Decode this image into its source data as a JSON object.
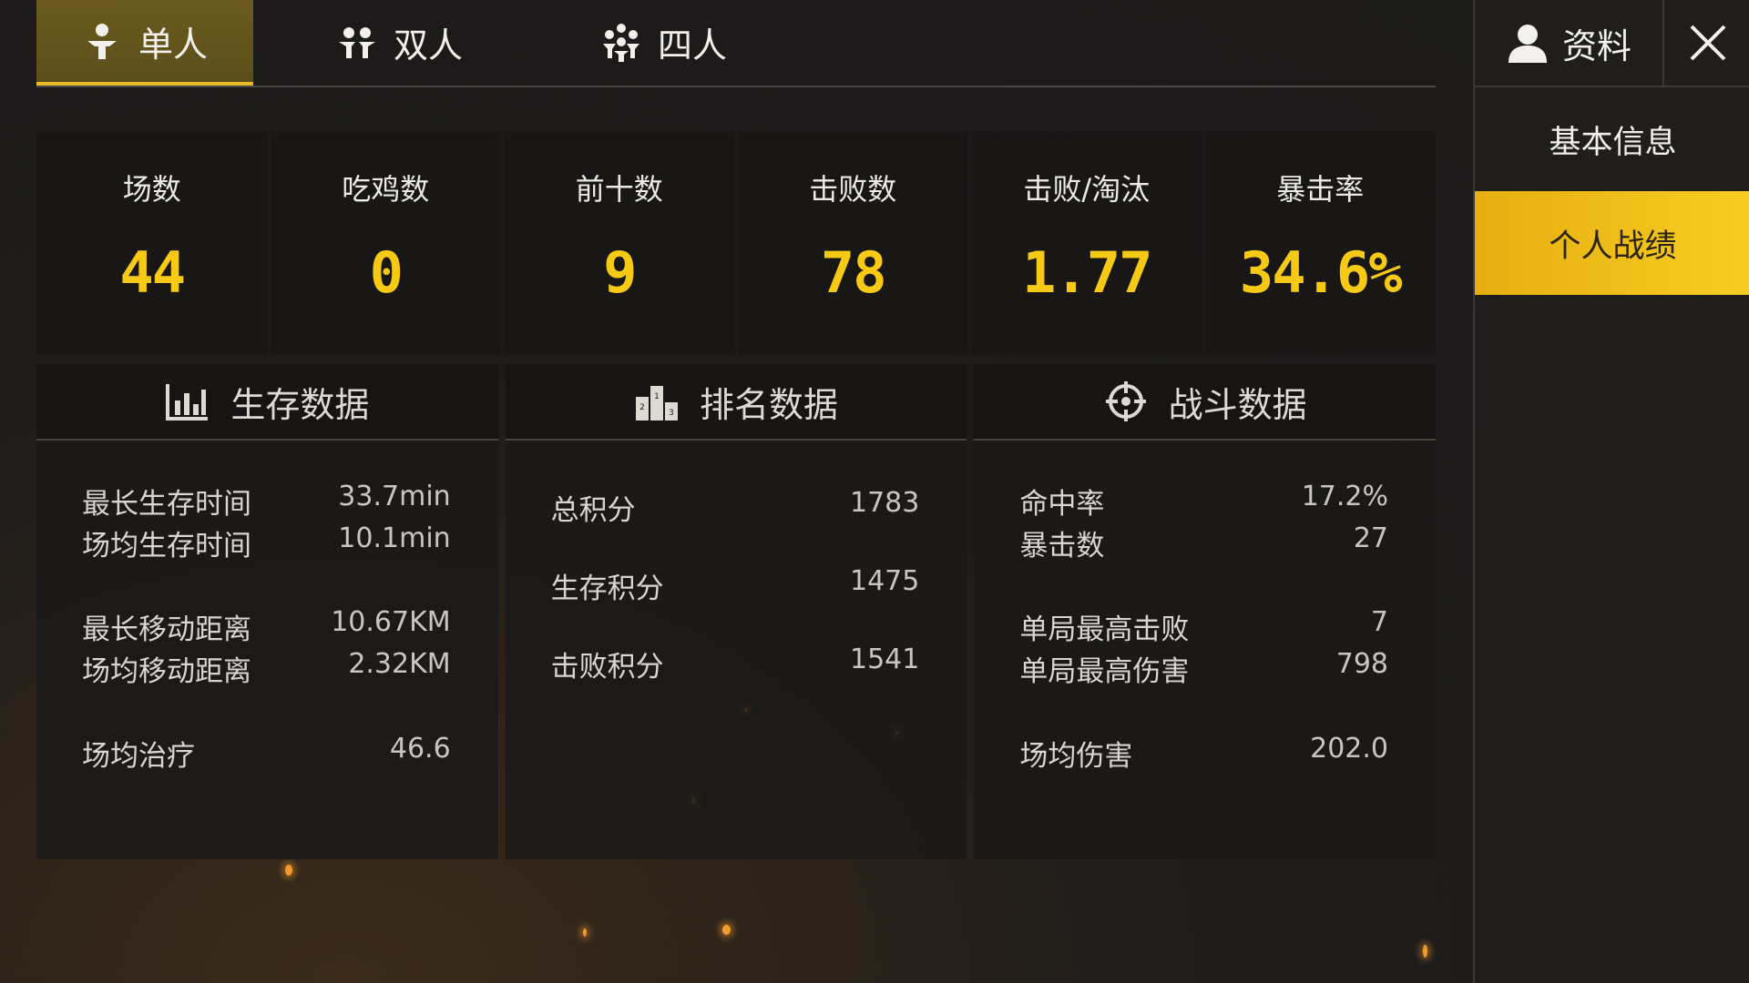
{
  "tabs": [
    {
      "label": "单人",
      "icon": "single-person-icon",
      "active": true
    },
    {
      "label": "双人",
      "icon": "duo-icon",
      "active": false
    },
    {
      "label": "四人",
      "icon": "squad-icon",
      "active": false
    }
  ],
  "stats": [
    {
      "label": "场数",
      "value": "44"
    },
    {
      "label": "吃鸡数",
      "value": "0"
    },
    {
      "label": "前十数",
      "value": "9"
    },
    {
      "label": "击败数",
      "value": "78"
    },
    {
      "label": "击败/淘汰",
      "value": "1.77"
    },
    {
      "label": "暴击率",
      "value": "34.6%"
    }
  ],
  "panels": {
    "survival": {
      "title": "生存数据",
      "rows": [
        {
          "k": "最长生存时间",
          "v": "33.7min"
        },
        {
          "k": "场均生存时间",
          "v": "10.1min"
        },
        {
          "k": "最长移动距离",
          "v": "10.67KM"
        },
        {
          "k": "场均移动距离",
          "v": "2.32KM"
        },
        {
          "k": "场均治疗",
          "v": "46.6"
        }
      ]
    },
    "ranking": {
      "title": "排名数据",
      "rows": [
        {
          "k": "总积分",
          "v": "1783"
        },
        {
          "k": "生存积分",
          "v": "1475"
        },
        {
          "k": "击败积分",
          "v": "1541"
        }
      ]
    },
    "combat": {
      "title": "战斗数据",
      "rows": [
        {
          "k": "命中率",
          "v": "17.2%"
        },
        {
          "k": "暴击数",
          "v": "27"
        },
        {
          "k": "单局最高击败",
          "v": "7"
        },
        {
          "k": "单局最高伤害",
          "v": "798"
        },
        {
          "k": "场均伤害",
          "v": "202.0"
        }
      ]
    }
  },
  "sidebar": {
    "profile_label": "资料",
    "items": [
      {
        "label": "基本信息",
        "active": false
      },
      {
        "label": "个人战绩",
        "active": true
      }
    ]
  },
  "colors": {
    "accent": "#f6c915",
    "tab_active": "#5c4f1b",
    "side_active": "#f2c01c"
  }
}
